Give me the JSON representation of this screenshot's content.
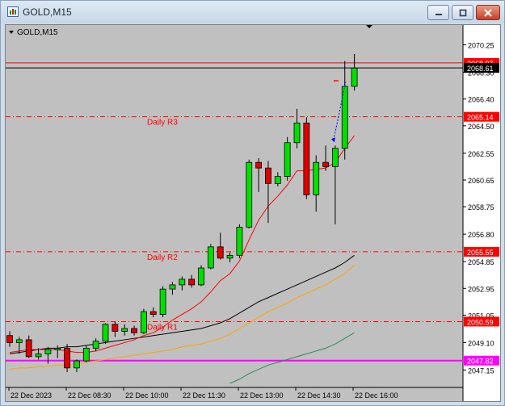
{
  "window": {
    "title": "GOLD,M15",
    "minimize_icon": "minimize-icon",
    "restore_icon": "restore-icon",
    "close_icon": "close-icon"
  },
  "chart_label": "GOLD,M15",
  "colors": {
    "bull": "#00e000",
    "bear": "#e00000",
    "pivot": "#ff0000",
    "ma_red": "#ff0000",
    "ma_black": "#000000",
    "ma_orange": "#ffa500",
    "ma_green": "#2e8b57",
    "magenta": "#ff00ff",
    "background": "#c0c0c0"
  },
  "chart_data": {
    "type": "candlestick",
    "symbol": "GOLD",
    "timeframe": "M15",
    "ylim": [
      2046.2,
      2071.2
    ],
    "y_ticks": [
      "2070.25",
      "2068.30",
      "2066.40",
      "2064.50",
      "2062.55",
      "2060.65",
      "2058.75",
      "2056.80",
      "2054.85",
      "2052.95",
      "2051.05",
      "2049.10",
      "2047.15"
    ],
    "x_ticks": [
      "22 Dec 2023",
      "22 Dec 08:30",
      "22 Dec 10:00",
      "22 Dec 11:30",
      "22 Dec 13:00",
      "22 Dec 14:30",
      "22 Dec 16:00"
    ],
    "candles": [
      {
        "o": 2049.6,
        "h": 2049.9,
        "l": 2048.8,
        "c": 2049.1
      },
      {
        "o": 2049.1,
        "h": 2049.5,
        "l": 2048.3,
        "c": 2049.3
      },
      {
        "o": 2049.3,
        "h": 2049.6,
        "l": 2048.0,
        "c": 2048.1
      },
      {
        "o": 2048.1,
        "h": 2048.7,
        "l": 2047.9,
        "c": 2048.3
      },
      {
        "o": 2048.3,
        "h": 2048.8,
        "l": 2047.6,
        "c": 2048.6
      },
      {
        "o": 2048.6,
        "h": 2048.9,
        "l": 2048.0,
        "c": 2048.7
      },
      {
        "o": 2048.7,
        "h": 2049.0,
        "l": 2047.0,
        "c": 2047.3
      },
      {
        "o": 2047.3,
        "h": 2047.9,
        "l": 2047.0,
        "c": 2047.8
      },
      {
        "o": 2047.8,
        "h": 2048.9,
        "l": 2047.7,
        "c": 2048.7
      },
      {
        "o": 2048.7,
        "h": 2049.4,
        "l": 2048.5,
        "c": 2049.2
      },
      {
        "o": 2049.2,
        "h": 2050.5,
        "l": 2049.0,
        "c": 2050.4
      },
      {
        "o": 2050.4,
        "h": 2050.6,
        "l": 2049.5,
        "c": 2049.9
      },
      {
        "o": 2049.9,
        "h": 2050.4,
        "l": 2049.6,
        "c": 2050.1
      },
      {
        "o": 2050.1,
        "h": 2050.3,
        "l": 2049.6,
        "c": 2049.8
      },
      {
        "o": 2049.8,
        "h": 2051.5,
        "l": 2049.7,
        "c": 2051.3
      },
      {
        "o": 2051.3,
        "h": 2051.6,
        "l": 2050.9,
        "c": 2051.1
      },
      {
        "o": 2051.1,
        "h": 2053.1,
        "l": 2050.9,
        "c": 2052.9
      },
      {
        "o": 2052.9,
        "h": 2053.4,
        "l": 2052.5,
        "c": 2053.2
      },
      {
        "o": 2053.2,
        "h": 2053.8,
        "l": 2052.8,
        "c": 2053.6
      },
      {
        "o": 2053.6,
        "h": 2053.9,
        "l": 2053.0,
        "c": 2053.2
      },
      {
        "o": 2053.2,
        "h": 2054.6,
        "l": 2053.1,
        "c": 2054.4
      },
      {
        "o": 2054.4,
        "h": 2056.1,
        "l": 2054.3,
        "c": 2055.9
      },
      {
        "o": 2055.9,
        "h": 2056.9,
        "l": 2055.0,
        "c": 2055.1
      },
      {
        "o": 2055.1,
        "h": 2055.5,
        "l": 2054.8,
        "c": 2055.3
      },
      {
        "o": 2055.3,
        "h": 2057.5,
        "l": 2055.1,
        "c": 2057.3
      },
      {
        "o": 2057.3,
        "h": 2062.1,
        "l": 2057.2,
        "c": 2061.9
      },
      {
        "o": 2061.9,
        "h": 2062.2,
        "l": 2059.8,
        "c": 2061.5
      },
      {
        "o": 2061.5,
        "h": 2062.0,
        "l": 2057.6,
        "c": 2060.4
      },
      {
        "o": 2060.4,
        "h": 2061.2,
        "l": 2060.2,
        "c": 2060.9
      },
      {
        "o": 2060.9,
        "h": 2063.7,
        "l": 2060.6,
        "c": 2063.3
      },
      {
        "o": 2063.3,
        "h": 2065.7,
        "l": 2062.9,
        "c": 2064.7
      },
      {
        "o": 2064.7,
        "h": 2065.1,
        "l": 2059.3,
        "c": 2059.6
      },
      {
        "o": 2059.6,
        "h": 2062.4,
        "l": 2058.4,
        "c": 2061.9
      },
      {
        "o": 2061.9,
        "h": 2063.1,
        "l": 2061.3,
        "c": 2061.6
      },
      {
        "o": 2061.6,
        "h": 2063.1,
        "l": 2057.5,
        "c": 2062.9
      },
      {
        "o": 2062.9,
        "h": 2069.1,
        "l": 2062.1,
        "c": 2067.3
      },
      {
        "o": 2067.3,
        "h": 2069.6,
        "l": 2067.0,
        "c": 2068.6
      }
    ],
    "pivot_levels": [
      {
        "name": "Daily R3",
        "value": 2065.14,
        "label": "2065.14"
      },
      {
        "name": "Daily R2",
        "value": 2055.55,
        "label": "2055.55"
      },
      {
        "name": "Daily R1",
        "value": 2050.59,
        "label": "2050.59"
      }
    ],
    "price_lines": [
      {
        "value": 2068.97,
        "label": "2068.97",
        "kind": "ask"
      },
      {
        "value": 2068.61,
        "label": "2068.61",
        "kind": "bid"
      },
      {
        "value": 2047.82,
        "label": "2047.82",
        "kind": "magenta"
      }
    ],
    "ma_red": [
      2048.4,
      2048.5,
      2048.6,
      2048.6,
      2048.6,
      2048.6,
      2048.5,
      2048.4,
      2048.4,
      2048.5,
      2048.7,
      2048.9,
      2049.1,
      2049.3,
      2049.6,
      2049.8,
      2050.2,
      2050.7,
      2051.1,
      2051.5,
      2052.0,
      2052.7,
      2053.5,
      2054.0,
      2054.9,
      2056.4,
      2057.8,
      2058.8,
      2059.5,
      2060.3,
      2061.3,
      2061.3,
      2061.4,
      2061.5,
      2061.9,
      2062.9,
      2063.8
    ],
    "ma_black": [
      2048.3,
      2048.4,
      2048.5,
      2048.6,
      2048.7,
      2048.7,
      2048.8,
      2048.8,
      2048.9,
      2049.0,
      2049.1,
      2049.2,
      2049.3,
      2049.4,
      2049.5,
      2049.6,
      2049.7,
      2049.8,
      2049.9,
      2050.0,
      2050.1,
      2050.3,
      2050.5,
      2050.8,
      2051.2,
      2051.6,
      2052.0,
      2052.3,
      2052.6,
      2052.9,
      2053.2,
      2053.5,
      2053.8,
      2054.1,
      2054.4,
      2054.8,
      2055.3
    ],
    "ma_orange": [
      2047.2,
      2047.3,
      2047.3,
      2047.4,
      2047.4,
      2047.5,
      2047.5,
      2047.6,
      2047.7,
      2047.8,
      2047.9,
      2048.0,
      2048.1,
      2048.2,
      2048.3,
      2048.4,
      2048.5,
      2048.6,
      2048.8,
      2048.9,
      2049.0,
      2049.2,
      2049.4,
      2049.7,
      2050.1,
      2050.5,
      2050.9,
      2051.3,
      2051.6,
      2051.9,
      2052.3,
      2052.6,
      2052.9,
      2053.2,
      2053.6,
      2054.0,
      2054.6
    ],
    "ma_green_start_index": 23,
    "ma_green": [
      2046.2,
      2046.5,
      2046.9,
      2047.2,
      2047.5,
      2047.7,
      2047.9,
      2048.1,
      2048.3,
      2048.5,
      2048.7,
      2049.0,
      2049.4,
      2049.8
    ]
  }
}
